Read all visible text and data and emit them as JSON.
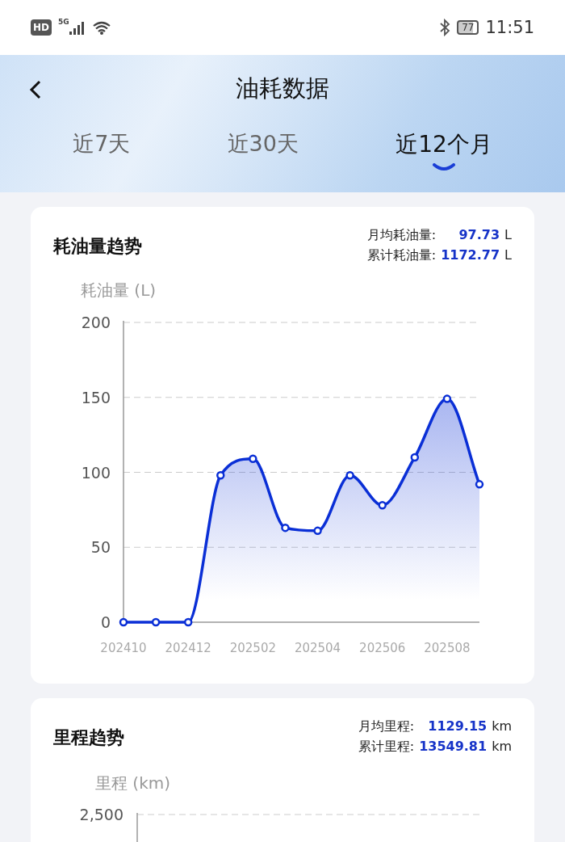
{
  "status_bar": {
    "hd_badge": "HD",
    "network": "5G",
    "battery": "77",
    "time": "11:51"
  },
  "header": {
    "title": "油耗数据"
  },
  "tabs": [
    {
      "label": "近7天",
      "selected": false
    },
    {
      "label": "近30天",
      "selected": false
    },
    {
      "label": "近12个月",
      "selected": true
    }
  ],
  "fuel_card": {
    "title": "耗油量趋势",
    "stats": [
      {
        "label": "月均耗油量:",
        "value": "97.73",
        "unit": "L"
      },
      {
        "label": "累计耗油量:",
        "value": "1172.77",
        "unit": "L"
      }
    ],
    "chart_data": {
      "type": "area",
      "ylabel": "耗油量 (L)",
      "categories": [
        "202410",
        null,
        "202412",
        null,
        "202502",
        null,
        "202504",
        null,
        "202506",
        null,
        "202508",
        null
      ],
      "grid": true,
      "series": [
        {
          "color": "#0a2fd6",
          "values": [
            0,
            0,
            0,
            98,
            109,
            63,
            61,
            98,
            78,
            110,
            149,
            92
          ]
        }
      ],
      "ylim": [
        0,
        200
      ],
      "yticks": [
        0,
        50,
        100,
        150,
        200
      ]
    }
  },
  "mileage_card": {
    "title": "里程趋势",
    "stats": [
      {
        "label": "月均里程:",
        "value": "1129.15",
        "unit": "km"
      },
      {
        "label": "累计里程:",
        "value": "13549.81",
        "unit": "km"
      }
    ],
    "axis_label": "里程 (km)",
    "top_tick": "2,500"
  }
}
